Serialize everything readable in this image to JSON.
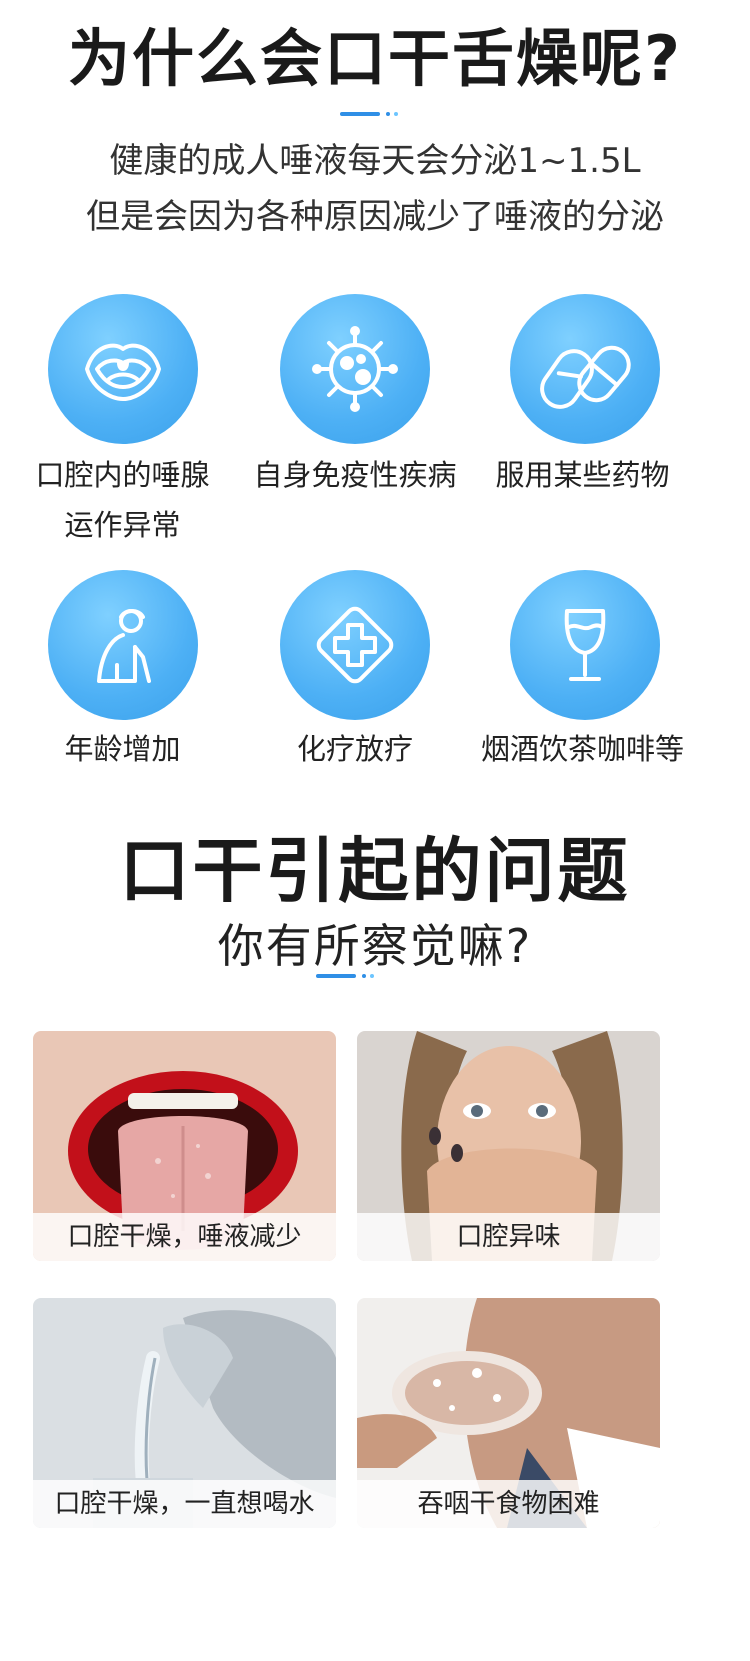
{
  "header": {
    "title": "为什么会口干舌燥呢?",
    "intro_line1": "健康的成人唾液每天会分泌1~1.5L",
    "intro_line2": "但是会因为各种原因减少了唾液的分泌"
  },
  "causes": [
    {
      "icon": "mouth-throat-icon",
      "line1": "口腔内的唾腺",
      "line2": "运作异常"
    },
    {
      "icon": "virus-icon",
      "line1": "自身免疫性疾病",
      "line2": ""
    },
    {
      "icon": "pills-icon",
      "line1": "服用某些药物",
      "line2": ""
    },
    {
      "icon": "elderly-person-icon",
      "line1": "年龄增加",
      "line2": ""
    },
    {
      "icon": "medical-cross-icon",
      "line1": "化疗放疗",
      "line2": ""
    },
    {
      "icon": "wine-glass-icon",
      "line1": "烟酒饮茶咖啡等",
      "line2": ""
    }
  ],
  "problems": {
    "title": "口干引起的问题",
    "subtitle": "你有所察觉嘛?",
    "cards": [
      {
        "photo": "dry-tongue-photo",
        "caption": "口腔干燥，唾液减少"
      },
      {
        "photo": "covering-mouth-photo",
        "caption": "口腔异味"
      },
      {
        "photo": "pouring-water-photo",
        "caption": "口腔干燥，一直想喝水"
      },
      {
        "photo": "eating-dry-food-photo",
        "caption": "吞咽干食物困难"
      }
    ]
  },
  "colors": {
    "accent": "#2f8fe6",
    "accent_light": "#6cc5ff",
    "circle": "#4db0f5"
  }
}
